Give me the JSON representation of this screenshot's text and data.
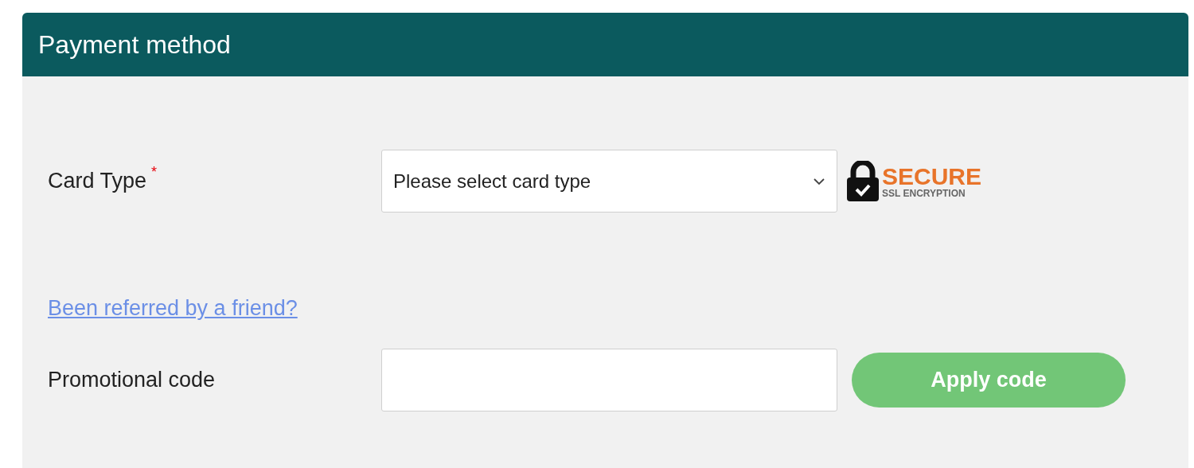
{
  "panel": {
    "title": "Payment method"
  },
  "card_type": {
    "label": "Card Type",
    "required": true,
    "required_mark": "*",
    "placeholder": "Please select card type"
  },
  "secure_badge": {
    "title": "SECURE",
    "subtitle": "SSL ENCRYPTION"
  },
  "referral_link": "Been referred by a friend?",
  "promo": {
    "label": "Promotional code",
    "button": "Apply code"
  }
}
